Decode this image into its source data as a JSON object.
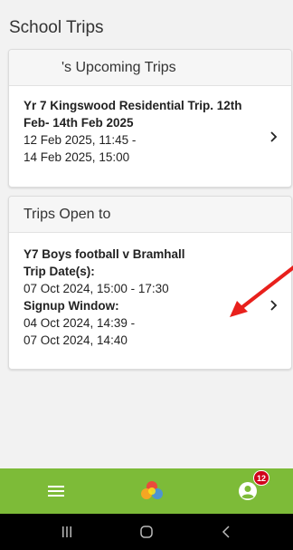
{
  "page": {
    "title": "School Trips"
  },
  "upcoming": {
    "header": "'s Upcoming Trips",
    "trip": {
      "title": "Yr 7 Kingswood Residential Trip. 12th Feb- 14th Feb 2025",
      "start": "12 Feb 2025, 11:45 -",
      "end": "14 Feb 2025, 15:00"
    }
  },
  "open": {
    "header": "Trips Open to",
    "trip": {
      "title": "Y7 Boys football v Bramhall",
      "dates_label": "Trip Date(s):",
      "dates_value": "07 Oct 2024, 15:00 - 17:30",
      "signup_label": "Signup Window:",
      "signup_start": "04 Oct 2024, 14:39 -",
      "signup_end": "07 Oct 2024, 14:40"
    }
  },
  "nav": {
    "menu_icon": "hamburger-icon",
    "home_icon": "app-logo-icon",
    "profile_icon": "user-icon",
    "notification_count": "12"
  },
  "colors": {
    "nav_bar": "#7dbb38",
    "badge": "#d0021b",
    "annotation_arrow": "#e8201c"
  }
}
